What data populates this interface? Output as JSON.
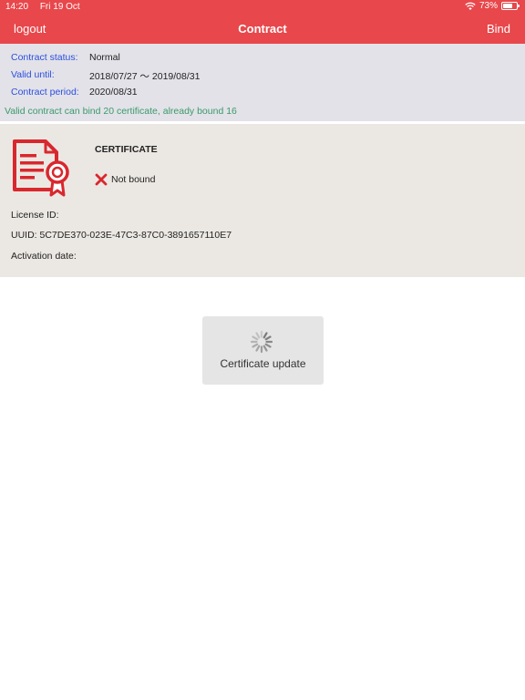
{
  "status_bar": {
    "time": "14:20",
    "date": "Fri 19 Oct",
    "battery": "73%",
    "battery_level": 0.73,
    "icons": [
      "wifi-icon",
      "battery-icon"
    ]
  },
  "nav": {
    "left_label": "logout",
    "title": "Contract",
    "right_label": "Bind"
  },
  "contract": {
    "status_label": "Contract status:",
    "status_value": "Normal",
    "valid_label": "Valid until:",
    "valid_value": "2018/07/27 ～ 2019/08/31",
    "period_label": "Contract period:",
    "period_value": "2020/08/31",
    "note": "Valid contract can bind 20 certificate, already bound 16"
  },
  "certificate": {
    "title": "CERTIFICATE",
    "bind_state": "Not bound",
    "license": "License ID:",
    "uuid": "UUID: 5C7DE370-023E-47C3-87C0-3891657110E7",
    "activation": "Activation date:",
    "icon": "certificate-icon"
  },
  "update_button": {
    "label": "Certificate update",
    "icon": "spinner-icon"
  },
  "colors": {
    "header": "#e8474b",
    "contract_bg": "#e3e2e8",
    "cert_bg": "#ebe8e3",
    "label_blue": "#2a4fe0",
    "note_green": "#3a9a6a",
    "icon_red": "#d9272e",
    "button_bg": "#e5e5e5"
  }
}
